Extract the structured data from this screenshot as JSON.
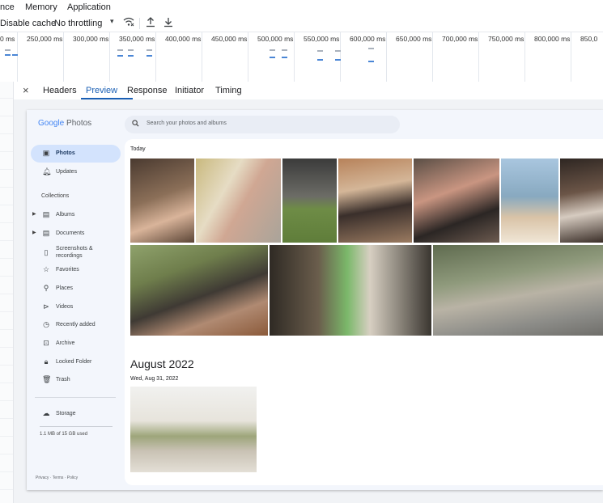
{
  "menu": {
    "items": [
      "nce",
      "Memory",
      "Application"
    ]
  },
  "toolbar": {
    "disable_cache": "Disable cache",
    "throttling": "No throttling",
    "icons": [
      "dropdown-caret",
      "wifi-conditions",
      "upload",
      "download"
    ]
  },
  "timeline": {
    "ticks": [
      "0 ms",
      "250,000 ms",
      "300,000 ms",
      "350,000 ms",
      "400,000 ms",
      "450,000 ms",
      "500,000 ms",
      "550,000 ms",
      "600,000 ms",
      "650,000 ms",
      "700,000 ms",
      "750,000 ms",
      "800,000 ms",
      "850,0"
    ],
    "accent": "#4a86d6"
  },
  "tabs": {
    "close": "×",
    "items": [
      "Headers",
      "Preview",
      "Response",
      "Initiator",
      "Timing"
    ],
    "active": "Preview"
  },
  "gphotos": {
    "logo_google": "Google",
    "logo_photos": " Photos",
    "search_placeholder": "Search your photos and albums",
    "nav": {
      "photos": "Photos",
      "updates": "Updates",
      "collections": "Collections",
      "albums": "Albums",
      "documents": "Documents",
      "screenshots": "Screenshots & recordings",
      "favorites": "Favorites",
      "places": "Places",
      "videos": "Videos",
      "recent": "Recently added",
      "archive": "Archive",
      "locked": "Locked Folder",
      "trash": "Trash",
      "storage": "Storage",
      "storage_used": "1.1 MB of 15 GB used"
    },
    "footer": "Privacy · Terms · Policy",
    "today": "Today",
    "month": "August 2022",
    "date": "Wed, Aug 31, 2022",
    "brand_colors": [
      "#4285f4",
      "#ea4335",
      "#fbbc05",
      "#34a853"
    ]
  }
}
